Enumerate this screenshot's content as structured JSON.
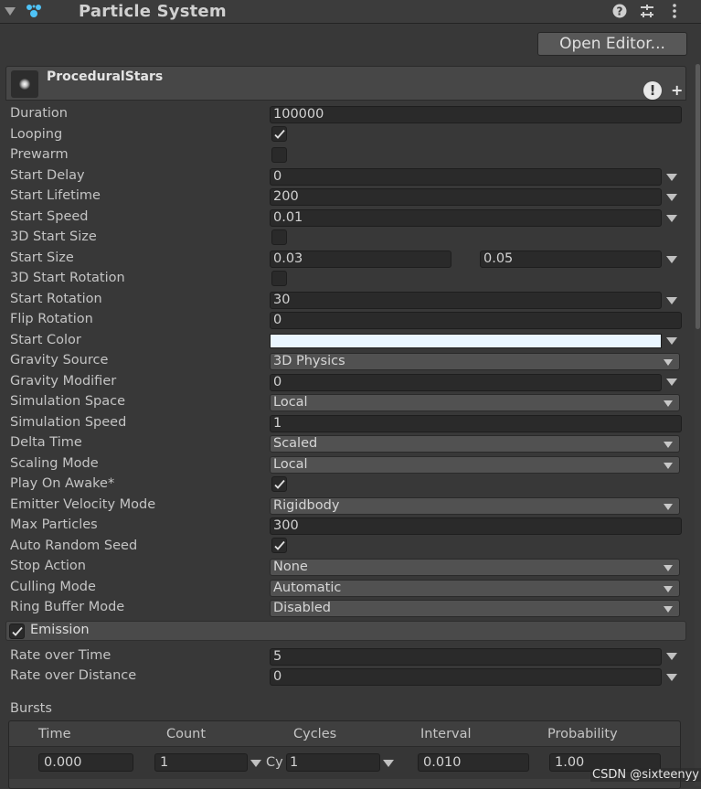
{
  "header": {
    "title": "Particle System"
  },
  "open_editor_label": "Open Editor...",
  "component": {
    "name": "ProceduralStars"
  },
  "rows": [
    {
      "label": "Duration",
      "type": "field",
      "value": "100000"
    },
    {
      "label": "Looping",
      "type": "checkbox",
      "checked": true
    },
    {
      "label": "Prewarm",
      "type": "checkbox",
      "checked": false
    },
    {
      "label": "Start Delay",
      "type": "field",
      "value": "0"
    },
    {
      "label": "Start Lifetime",
      "type": "field",
      "value": "200"
    },
    {
      "label": "Start Speed",
      "type": "field",
      "value": "0.01"
    },
    {
      "label": "3D Start Size",
      "type": "checkbox",
      "checked": false
    },
    {
      "label": "Start Size",
      "type": "range",
      "min": "0.03",
      "max": "0.05"
    },
    {
      "label": "3D Start Rotation",
      "type": "checkbox",
      "checked": false
    },
    {
      "label": "Start Rotation",
      "type": "field",
      "value": "30"
    },
    {
      "label": "Flip Rotation",
      "type": "field",
      "value": "0"
    },
    {
      "label": "Start Color",
      "type": "color",
      "value": "#eaf6ff"
    },
    {
      "label": "Gravity Source",
      "type": "dropdown",
      "value": "3D Physics"
    },
    {
      "label": "Gravity Modifier",
      "type": "field",
      "value": "0"
    },
    {
      "label": "Simulation Space",
      "type": "dropdown",
      "value": "Local"
    },
    {
      "label": "Simulation Speed",
      "type": "field",
      "value": "1"
    },
    {
      "label": "Delta Time",
      "type": "dropdown",
      "value": "Scaled"
    },
    {
      "label": "Scaling Mode",
      "type": "dropdown",
      "value": "Local"
    },
    {
      "label": "Play On Awake*",
      "type": "checkbox",
      "checked": true
    },
    {
      "label": "Emitter Velocity Mode",
      "type": "dropdown",
      "value": "Rigidbody"
    },
    {
      "label": "Max Particles",
      "type": "field",
      "value": "300"
    },
    {
      "label": "Auto Random Seed",
      "type": "checkbox",
      "checked": true
    },
    {
      "label": "Stop Action",
      "type": "dropdown",
      "value": "None"
    },
    {
      "label": "Culling Mode",
      "type": "dropdown",
      "value": "Automatic"
    },
    {
      "label": "Ring Buffer Mode",
      "type": "dropdown",
      "value": "Disabled"
    }
  ],
  "emission": {
    "label": "Emission",
    "enabled": true,
    "rate_over_time": {
      "label": "Rate over Time",
      "value": "5"
    },
    "rate_over_distance": {
      "label": "Rate over Distance",
      "value": "0"
    },
    "bursts": {
      "label": "Bursts",
      "columns": [
        "Time",
        "Count",
        "Cycles",
        "Interval",
        "Probability"
      ],
      "row": {
        "time": "0.000",
        "count": "1",
        "cycles_prefix": "Cy",
        "cycles": "1",
        "interval": "0.010",
        "probability": "1.00"
      }
    }
  },
  "watermark": "CSDN @sixteenyy"
}
